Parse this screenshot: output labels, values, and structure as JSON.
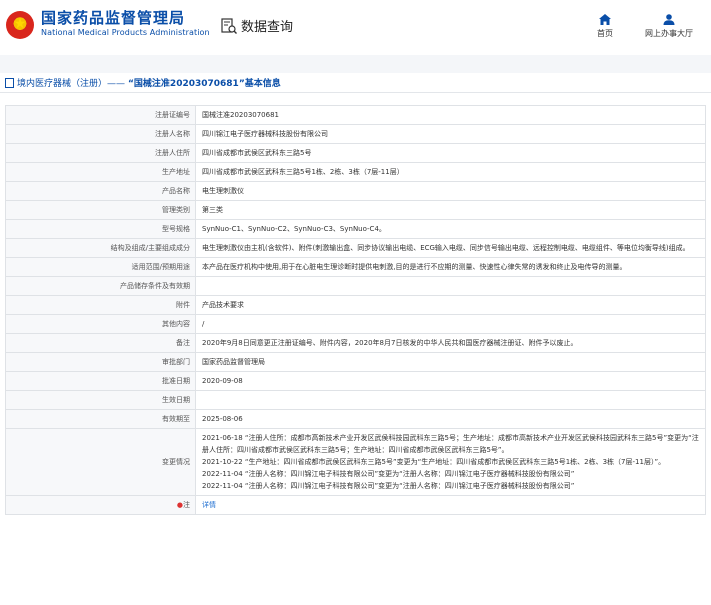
{
  "header": {
    "brand_cn": "国家药品监督管理局",
    "brand_en": "National Medical Products Administration",
    "search_label": "数据查询",
    "nav": [
      {
        "label": "首页",
        "icon": "home-icon"
      },
      {
        "label": "网上办事大厅",
        "icon": "user-icon"
      }
    ]
  },
  "breadcrumb": {
    "prefix": "境内医疗器械（注册）——",
    "title": "“国械注准20203070681”基本信息"
  },
  "rows": [
    {
      "key": "注册证编号",
      "value": "国械注准20203070681"
    },
    {
      "key": "注册人名称",
      "value": "四川锦江电子医疗器械科技股份有限公司"
    },
    {
      "key": "注册人住所",
      "value": "四川省成都市武侯区武科东三路5号"
    },
    {
      "key": "生产地址",
      "value": "四川省成都市武侯区武科东三路5号1栋、2栋、3栋（7层-11层）"
    },
    {
      "key": "产品名称",
      "value": "电生理刺激仪"
    },
    {
      "key": "管理类别",
      "value": "第三类"
    },
    {
      "key": "型号规格",
      "value": "SynNuo-C1、SynNuo-C2、SynNuo-C3、SynNuo-C4。"
    },
    {
      "key": "结构及组成/主要组成成分",
      "value": "电生理刺激仪由主机(含软件)、附件(刺激输出盒、同步协议输出电缆、ECG输入电缆、同步信号输出电缆、远程控制电缆、电缆组件、等电位均衡导线)组成。"
    },
    {
      "key": "适用范围/预期用途",
      "value": "本产品在医疗机构中使用,用于在心脏电生理诊断时提供电刺激,目的是进行不应期的测量、快速性心律失常的诱发和终止及电传导的测量。"
    },
    {
      "key": "产品储存条件及有效期",
      "value": ""
    },
    {
      "key": "附件",
      "value": "产品技术要求"
    },
    {
      "key": "其他内容",
      "value": "/"
    },
    {
      "key": "备注",
      "value": "2020年9月8日同意更正注册证编号、附件内容，2020年8月7日核发的中华人民共和国医疗器械注册证、附件予以废止。"
    },
    {
      "key": "审批部门",
      "value": "国家药品监督管理局"
    },
    {
      "key": "批准日期",
      "value": "2020-09-08"
    },
    {
      "key": "生效日期",
      "value": ""
    },
    {
      "key": "有效期至",
      "value": "2025-08-06"
    }
  ],
  "changes": {
    "key": "变更情况",
    "lines": [
      "2021-06-18 “注册人住所：成都市高新技术产业开发区武侯科技园武科东三路5号；生产地址：成都市高新技术产业开发区武侯科技园武科东三路5号”变更为“注册人住所：四川省成都市武侯区武科东三路5号；生产地址：四川省成都市武侯区武科东三路5号”。",
      "2021-10-22 “生产地址：四川省成都市武侯区武科东三路5号”变更为“生产地址：四川省成都市武侯区武科东三路5号1栋、2栋、3栋（7层-11层）”。",
      "2022-11-04 “注册人名称：四川锦江电子科技有限公司”变更为“注册人名称：四川锦江电子医疗器械科技股份有限公司”",
      "2022-11-04 “注册人名称：四川锦江电子科技有限公司”变更为“注册人名称：四川锦江电子医疗器械科技股份有限公司”"
    ]
  },
  "note": {
    "key": "注",
    "link": "详情"
  }
}
